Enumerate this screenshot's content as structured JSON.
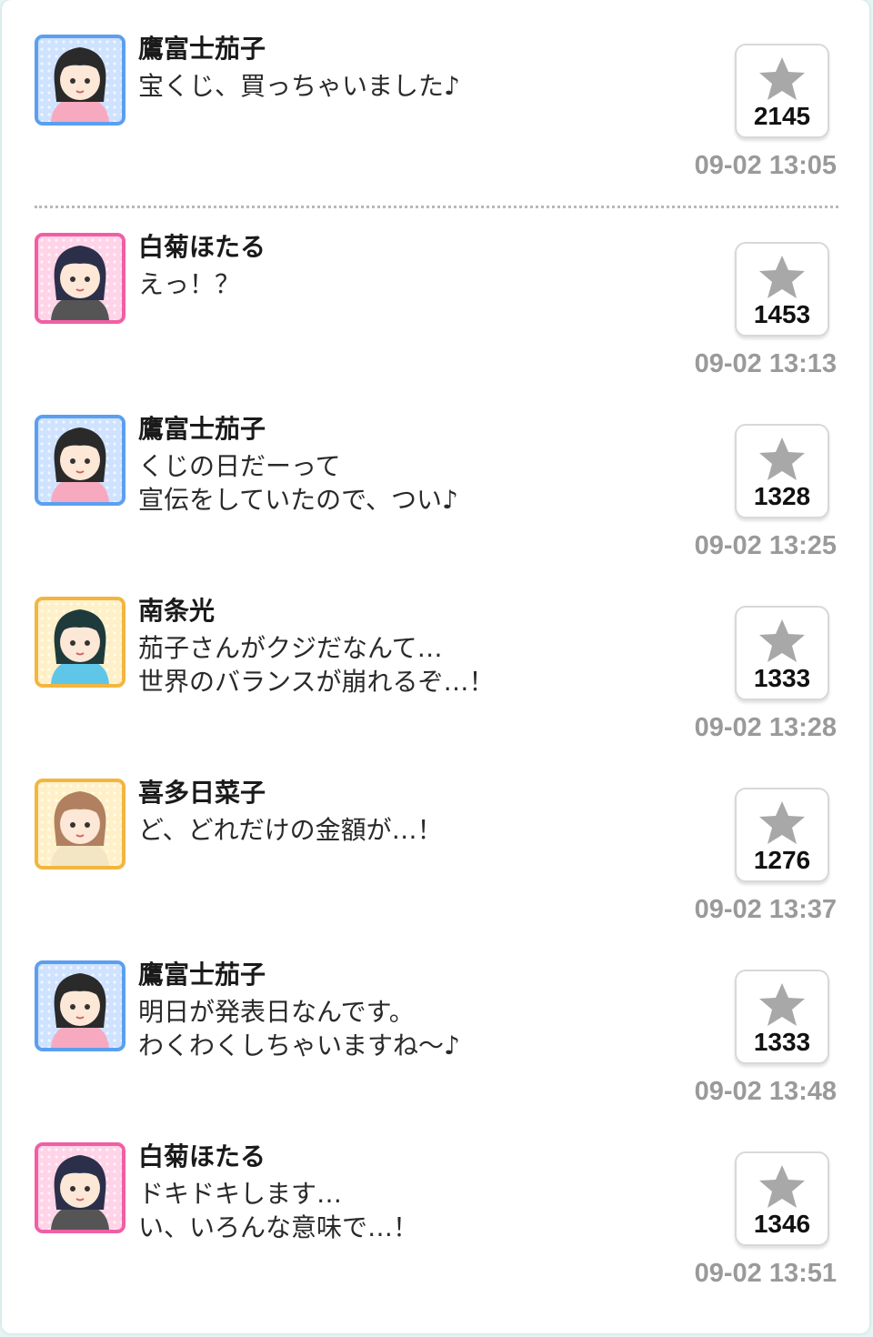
{
  "posts": [
    {
      "name": "鷹富士茄子",
      "lines": [
        "宝くじ、買っちゃいました♪"
      ],
      "likes": "2145",
      "time": "09-02 13:05",
      "avatar_border": "#5b9ff0",
      "avatar_bg": "#cfe2ff",
      "avatar_icon": "diamond-icon",
      "hair": "#2a2a2a",
      "outfit": "#f7a9c0"
    },
    {
      "name": "白菊ほたる",
      "lines": [
        "えっ！？"
      ],
      "likes": "1453",
      "time": "09-02 13:13",
      "avatar_border": "#f05fa4",
      "avatar_bg": "#ffd3e8",
      "avatar_icon": "flower-icon",
      "hair": "#2b2f4a",
      "outfit": "#555555"
    },
    {
      "name": "鷹富士茄子",
      "lines": [
        "くじの日だーって",
        "宣伝をしていたので、つい♪"
      ],
      "likes": "1328",
      "time": "09-02 13:25",
      "avatar_border": "#5b9ff0",
      "avatar_bg": "#cfe2ff",
      "avatar_icon": "diamond-icon",
      "hair": "#2a2a2a",
      "outfit": "#f7a9c0"
    },
    {
      "name": "南条光",
      "lines": [
        "茄子さんがクジだなんて…",
        "世界のバランスが崩れるぞ…！"
      ],
      "likes": "1333",
      "time": "09-02 13:28",
      "avatar_border": "#f2b640",
      "avatar_bg": "#fff0c8",
      "avatar_icon": "sun-icon",
      "hair": "#1f3a3a",
      "outfit": "#5fc6e8"
    },
    {
      "name": "喜多日菜子",
      "lines": [
        "ど、どれだけの金額が…！"
      ],
      "likes": "1276",
      "time": "09-02 13:37",
      "avatar_border": "#f2b640",
      "avatar_bg": "#fff0c8",
      "avatar_icon": "sun-icon",
      "hair": "#b08060",
      "outfit": "#f3e6c4"
    },
    {
      "name": "鷹富士茄子",
      "lines": [
        "明日が発表日なんです。",
        "わくわくしちゃいますね～♪"
      ],
      "likes": "1333",
      "time": "09-02 13:48",
      "avatar_border": "#5b9ff0",
      "avatar_bg": "#cfe2ff",
      "avatar_icon": "diamond-icon",
      "hair": "#2a2a2a",
      "outfit": "#f7a9c0"
    },
    {
      "name": "白菊ほたる",
      "lines": [
        "ドキドキします…",
        "い、いろんな意味で…！"
      ],
      "likes": "1346",
      "time": "09-02 13:51",
      "avatar_border": "#f05fa4",
      "avatar_bg": "#ffd3e8",
      "avatar_icon": "flower-icon",
      "hair": "#2b2f4a",
      "outfit": "#555555"
    }
  ],
  "colors": {
    "star": "#a8a8a8",
    "timestamp": "#9a9a9a",
    "background": "#e6f4f3"
  }
}
